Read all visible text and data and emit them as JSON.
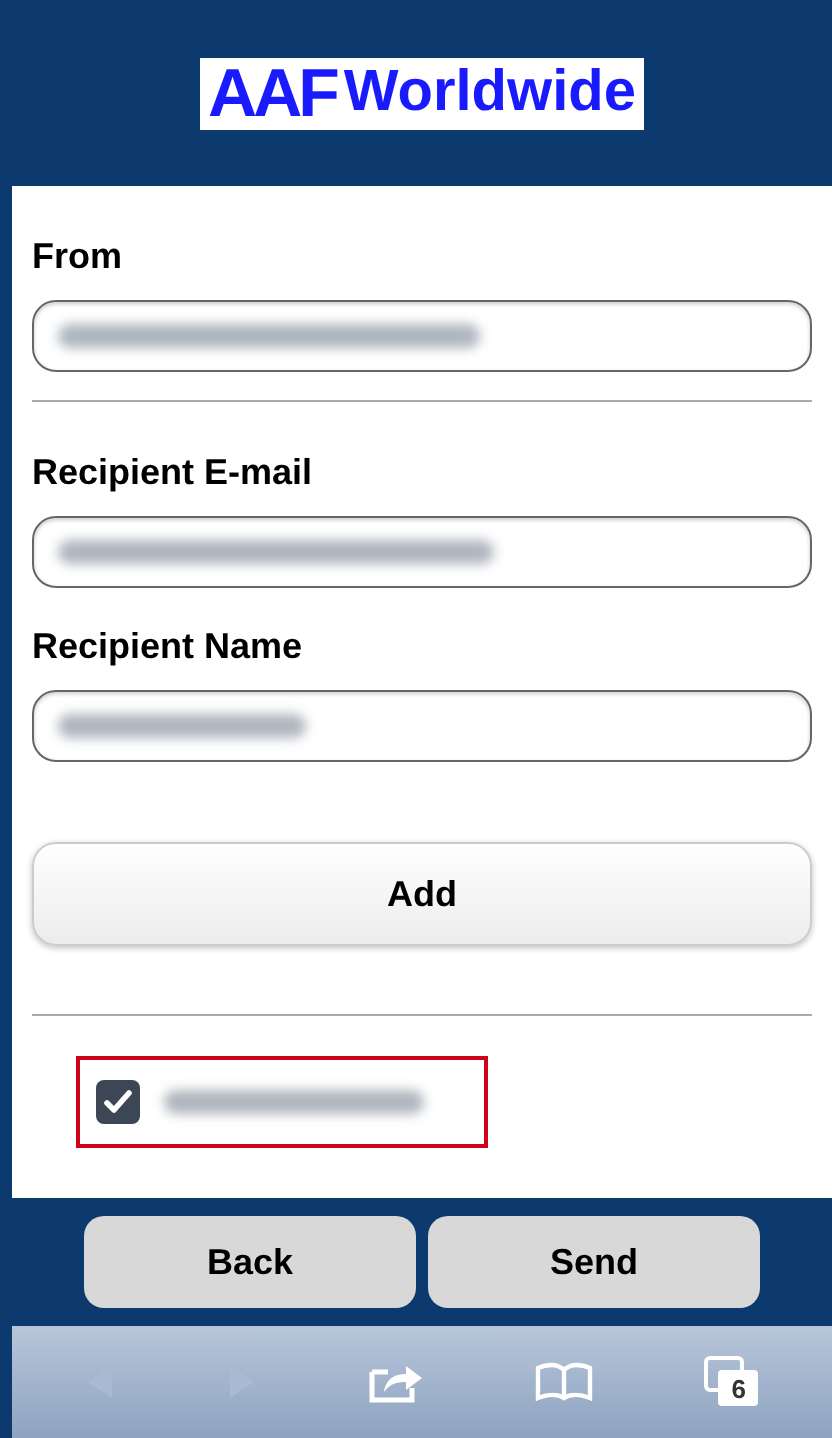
{
  "header": {
    "logo_mark": "AAF",
    "logo_text": "Worldwide"
  },
  "fields": [
    {
      "label": "From",
      "redacted": true,
      "divider_after": true
    },
    {
      "label": "Recipient E-mail",
      "redacted": true,
      "divider_after": false
    },
    {
      "label": "Recipient Name",
      "redacted": true,
      "divider_after": false
    }
  ],
  "add_button": "Add",
  "recipients": [
    {
      "checked": true,
      "redacted": true,
      "highlighted": true
    }
  ],
  "actions": [
    "Back",
    "Send"
  ],
  "browser_toolbar": {
    "back_disabled": true,
    "forward_disabled": true,
    "tab_count": "6"
  }
}
